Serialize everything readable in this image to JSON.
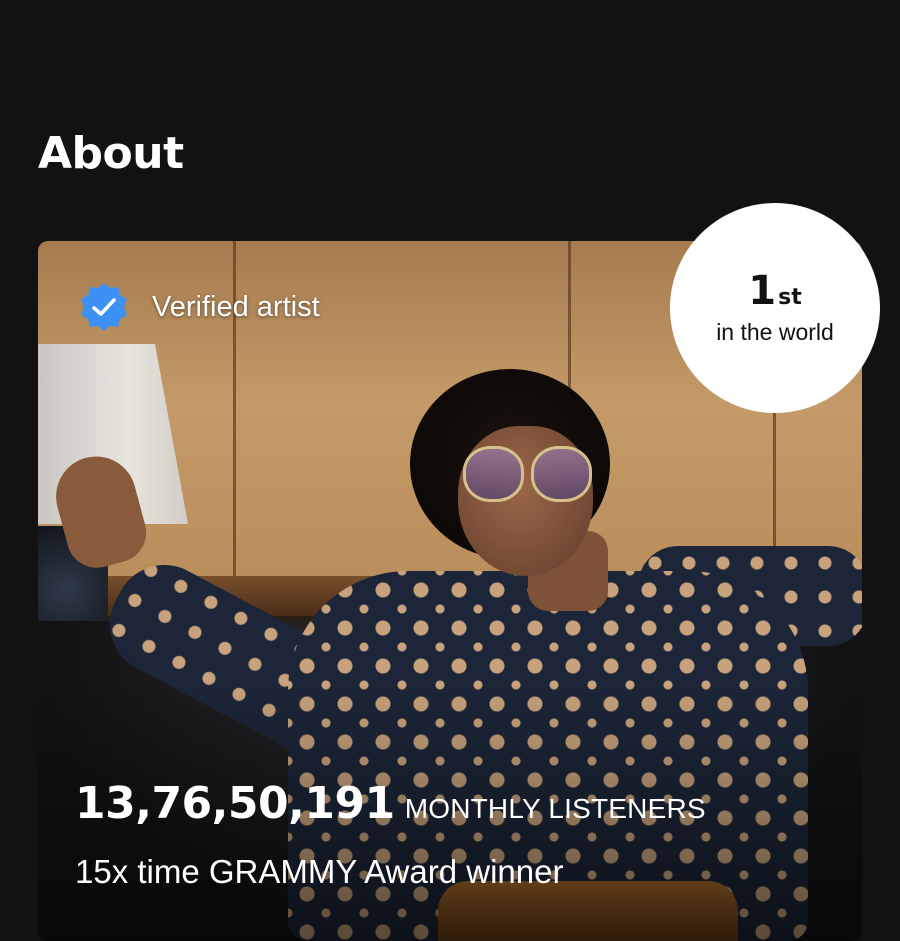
{
  "section": {
    "title": "About"
  },
  "artist_card": {
    "verified_label": "Verified artist",
    "monthly_listeners_count": "13,76,50,191",
    "monthly_listeners_label": "MONTHLY LISTENERS",
    "bio_line": "15x time GRAMMY Award winner"
  },
  "world_rank": {
    "number": "1",
    "suffix": "st",
    "caption": "in the world"
  },
  "icons": {
    "verified": "verified-check-badge-icon"
  },
  "colors": {
    "background": "#121212",
    "verified_badge": "#3d91f4",
    "text_primary": "#ffffff",
    "rank_bubble": "#ffffff"
  }
}
